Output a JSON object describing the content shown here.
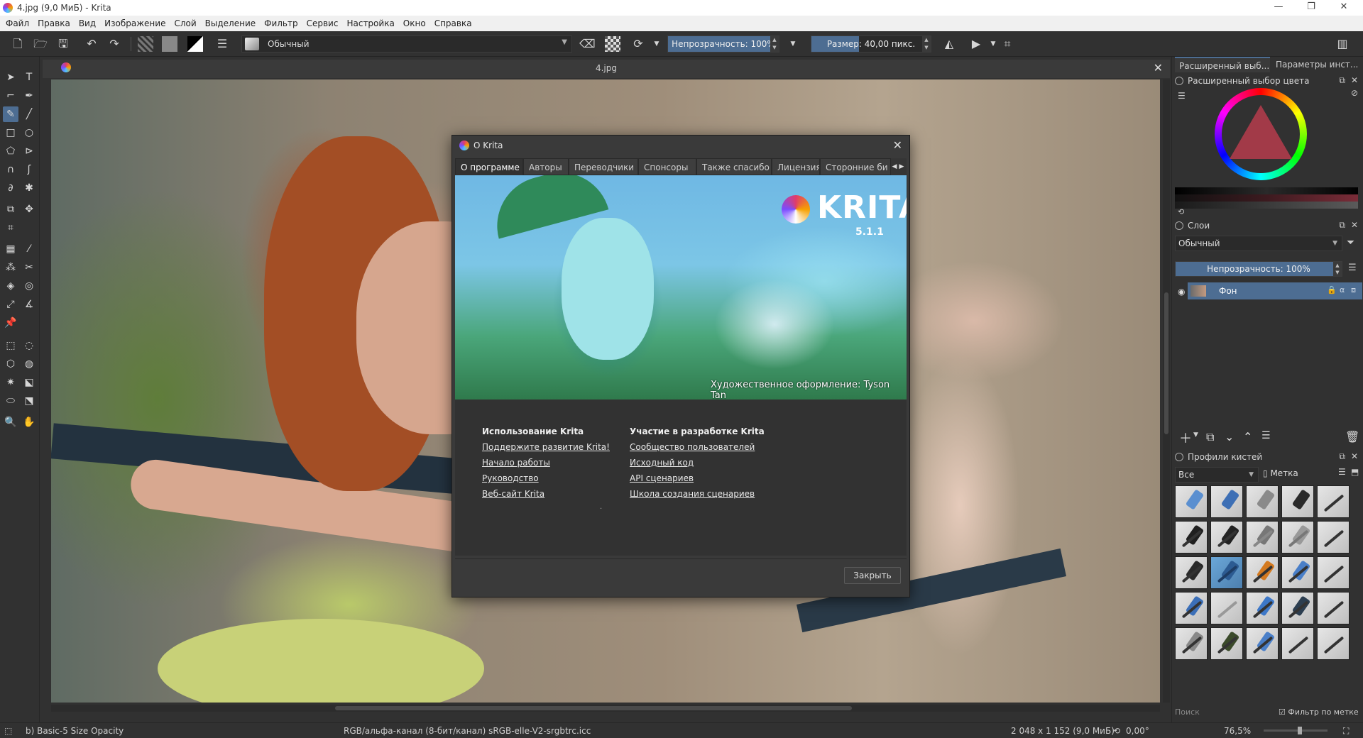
{
  "window": {
    "title": "4.jpg (9,0 МиБ)  - Krita",
    "minimize": "—",
    "restore": "❐",
    "close": "✕"
  },
  "menu": [
    "Файл",
    "Правка",
    "Вид",
    "Изображение",
    "Слой",
    "Выделение",
    "Фильтр",
    "Сервис",
    "Настройка",
    "Окно",
    "Справка"
  ],
  "toolbar": {
    "preset_name": "Обычный",
    "opacity": "Непрозрачность: 100%",
    "opacity_value": 1.0,
    "size": "Размер: 40,00 пикс.",
    "size_value": 0.4
  },
  "document": {
    "tab_title": "4.jpg",
    "close": "✕"
  },
  "dialog": {
    "title": "О Krita",
    "close": "✕",
    "tabs": [
      "О программе",
      "Авторы",
      "Переводчики",
      "Спонсоры",
      "Также спасибо",
      "Лицензия",
      "Сторонние би"
    ],
    "banner": {
      "logo": "KRITA",
      "version": "5.1.1",
      "credit": "Художественное оформление: Tyson Tan"
    },
    "left_column": {
      "heading": "Использование Krita",
      "links": [
        "Поддержите развитие Krita!",
        "Начало работы",
        "Руководство",
        "Веб-сайт Krita"
      ]
    },
    "right_column": {
      "heading": "Участие в разработке Krita",
      "links": [
        "Сообщество пользователей",
        "Исходный код",
        "API сценариев",
        "Школа создания сценариев"
      ]
    },
    "dot": ".",
    "close_button": "Закрыть"
  },
  "dock": {
    "tabs": [
      "Расширенный выб...",
      "Параметры инст..."
    ],
    "color_panel": "Расширенный выбор цвета",
    "layers_panel": "Слои",
    "blend_mode": "Обычный",
    "layer_opacity": "Непрозрачность:  100%",
    "layer_name": "Фон",
    "brushes_panel": "Профили кистей",
    "brush_filter": "Все",
    "brush_tag": "Метка",
    "search_placeholder": "Поиск",
    "tag_filter": "Фильтр по метке"
  },
  "status": {
    "brush": "b) Basic-5 Size Opacity",
    "color_model": "RGB/альфа-канал (8-бит/канал)  sRGB-elle-V2-srgbtrc.icc",
    "image_size": "2 048 x 1 152 (9,0 МиБ)",
    "rotation": "0,00°",
    "zoom": "76,5%"
  },
  "colors": {
    "accent": "#4d6d92",
    "bg": "#313131",
    "dialog_bg": "#3a3a3a"
  }
}
